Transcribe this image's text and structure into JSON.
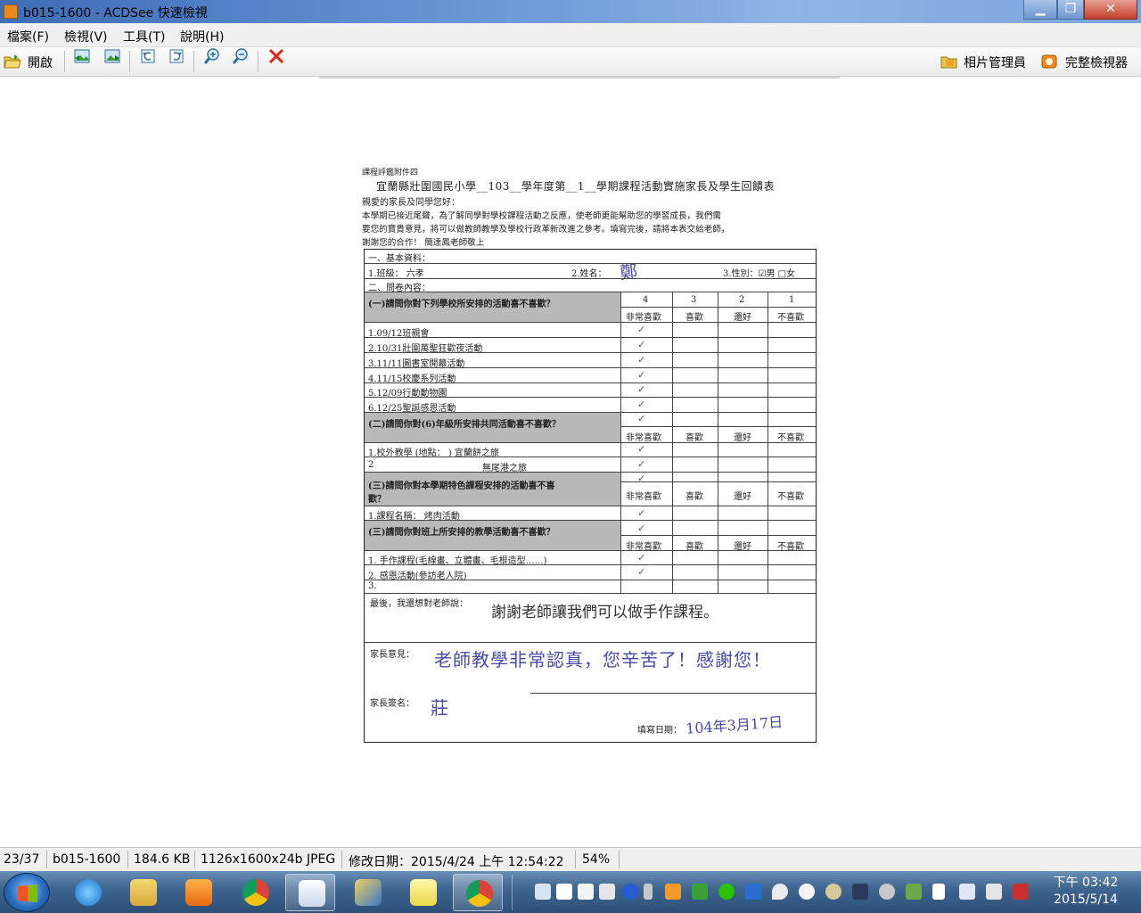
{
  "window": {
    "title": "b015-1600 - ACDSee 快速檢視",
    "minimize_glyph": "▁",
    "maximize_glyph": "❐",
    "close_glyph": "✕"
  },
  "menu": {
    "items": [
      {
        "label": "檔案(F)"
      },
      {
        "label": "檢視(V)"
      },
      {
        "label": "工具(T)"
      },
      {
        "label": "說明(H)"
      }
    ]
  },
  "toolbar": {
    "open_label": "開啟",
    "photo_manager_label": "相片管理員",
    "full_viewer_label": "完整檢視器",
    "icons": [
      "open-folder-icon",
      "previous-image-icon",
      "next-image-icon",
      "rotate-left-icon",
      "rotate-right-icon",
      "zoom-in-icon",
      "zoom-out-icon",
      "delete-icon"
    ]
  },
  "document": {
    "heading_small": "課程評鑑附件四",
    "title": "宜蘭縣壯圍國民小學__103__學年度第__1__學期課程活動實施家長及學生回饋表",
    "greeting": "親愛的家長及同學您好：",
    "intro_1": "本學期已接近尾聲，為了解同學對學校課程活動之反應，使老師更能幫助您的學習成長，我們需",
    "intro_2": "要您的寶貴意見，將可以做教師教學及學校行政革新改進之參考。填寫完後，請將本表交給老師，",
    "intro_3": "謝謝您的合作！  簡達鳳老師敬上",
    "sec1": "一、基本資料：",
    "class_label": "1.班級：  六孝",
    "name_label": "2.姓名：",
    "name_value": "鄭",
    "gender_label": "3.性別：☑男  □女",
    "sec2": "二、問卷內容：",
    "q1": "(一)請問你對下列學校所安排的活動喜不喜歡？",
    "scale_nums": [
      "4",
      "3",
      "2",
      "1"
    ],
    "scale_labels": [
      "非常喜歡",
      "喜歡",
      "還好",
      "不喜歡"
    ],
    "q1_items": [
      "1.09/12班親會",
      "2.10/31壯圍萬聖狂歡夜活動",
      "3.11/11圖書室開幕活動",
      "4.11/15校慶系列活動",
      "5.12/09行動動物園",
      "6.12/25聖誕感恩活動"
    ],
    "q2": "(二)請問你對(6)年級所安排共同活動喜不喜歡？",
    "q2_item_1": "1.校外教學 (地點：  ) 宜蘭餅之旅",
    "q2_item_2a": "2",
    "q2_item_2b": "無尾港之旅",
    "q3": "(三)請問你對本學期特色課程安排的活動喜不喜",
    "q3b": "歡？",
    "q3_item": "1.課程名稱：  烤肉活動",
    "q4": "(三)請問你對班上所安排的教學活動喜不喜歡？",
    "q4_items": [
      "1. 手作課程(毛線畫、立體畫、毛根造型……)",
      "2. 感恩活動(參訪老人院)",
      "3."
    ],
    "check_mark": "✓",
    "final_label": "最後，我還想對老師說：",
    "final_handwriting": "謝謝老師讓我們可以做手作課程。",
    "parent_label": "家長意見：",
    "parent_handwriting": "老師教學非常認真，您辛苦了！感謝您！",
    "sign_label": "家長簽名：",
    "sign_value": "莊",
    "date_label": "填寫日期：",
    "date_value": "104年3月17日"
  },
  "status": {
    "index": "23/37",
    "filename": "b015-1600",
    "filesize": "184.6 KB",
    "dimensions": "1126x1600x24b JPEG",
    "modified": "修改日期：2015/4/24 上午 12:54:22",
    "zoom": "54%"
  },
  "taskbar": {
    "apps": [
      "internet-explorer-icon",
      "file-explorer-icon",
      "media-player-icon",
      "chrome-icon",
      "paint-icon",
      "pen-tool-icon",
      "sticky-notes-icon",
      "chrome-window-icon"
    ],
    "tray_icons": [
      "display-icon",
      "font-icon",
      "doc-icon",
      "keyboard-icon",
      "help-icon",
      "settings-icon",
      "camera-icon",
      "monitor-icon",
      "wechat-icon",
      "bluetooth-icon",
      "location-icon",
      "clock-app-icon",
      "vpn-icon",
      "screen-capture-icon",
      "disc-icon",
      "photo-icon",
      "flag-icon",
      "network-icon",
      "volume-icon",
      "ime-icon"
    ],
    "time": "下午 03:42",
    "date": "2015/5/14"
  }
}
